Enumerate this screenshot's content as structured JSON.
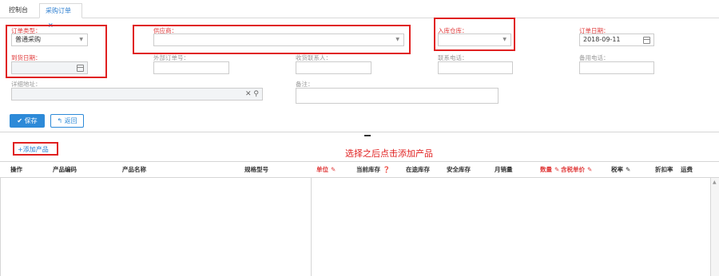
{
  "tabs": [
    {
      "label": "控制台"
    },
    {
      "label": "采购订单",
      "close": "×"
    }
  ],
  "form": {
    "order_type": {
      "label": "订单类型：",
      "value": "普通采购"
    },
    "supplier": {
      "label": "供应商：",
      "value": ""
    },
    "warehouse": {
      "label": "入库仓库：",
      "value": ""
    },
    "order_date": {
      "label": "订单日期：",
      "value": "2018-09-11"
    },
    "arrival_date": {
      "label": "到货日期：",
      "value": ""
    },
    "external_no": {
      "label": "外部订单号：",
      "value": ""
    },
    "receiver": {
      "label": "收货联系人：",
      "value": ""
    },
    "phone": {
      "label": "联系电话：",
      "value": ""
    },
    "backup_phone": {
      "label": "备用电话：",
      "value": ""
    },
    "address": {
      "label": "详细地址：",
      "value": ""
    },
    "remark": {
      "label": "备注：",
      "value": ""
    }
  },
  "buttons": {
    "save": "✔ 保存",
    "back": "↰ 返回"
  },
  "add_product": "+添加产品",
  "hint": "选择之后点击添加产品",
  "columns": [
    {
      "label": "操作",
      "red": false,
      "edit": ""
    },
    {
      "label": "产品编码",
      "red": false,
      "edit": ""
    },
    {
      "label": "产品名称",
      "red": false,
      "edit": ""
    },
    {
      "label": "规格型号",
      "red": false,
      "edit": ""
    },
    {
      "label": "单位",
      "red": true,
      "edit": "✎"
    },
    {
      "label": "当前库存",
      "red": false,
      "edit": "❓"
    },
    {
      "label": "在途库存",
      "red": false,
      "edit": ""
    },
    {
      "label": "安全库存",
      "red": false,
      "edit": ""
    },
    {
      "label": "月销量",
      "red": false,
      "edit": ""
    },
    {
      "label": "数量",
      "red": true,
      "edit": "✎"
    },
    {
      "label": "含税单价",
      "red": true,
      "edit": "✎"
    },
    {
      "label": "税率",
      "red": false,
      "edit": "✎"
    },
    {
      "label": "折扣率",
      "red": false,
      "edit": ""
    },
    {
      "label": "运费",
      "red": false,
      "edit": ""
    }
  ],
  "colors": {
    "accent": "#2d8ad8",
    "required": "#e03a3a",
    "highlight": "#e02020"
  }
}
